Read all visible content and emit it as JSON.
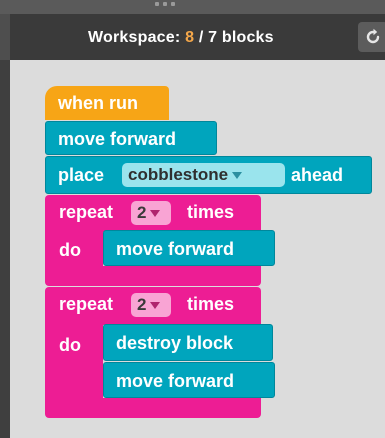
{
  "header": {
    "title_prefix": "Workspace: ",
    "blocks_used": "8",
    "title_suffix": " / 7 blocks"
  },
  "colors": {
    "event_block": "#f7a516",
    "action_block": "#00a5bd",
    "loop_block": "#ed1d94",
    "over_limit": "#f4a74a"
  },
  "program": {
    "when_run": "when run",
    "move_forward_1": "move forward",
    "place_label": "place",
    "place_block_option": "cobblestone",
    "place_suffix": "ahead",
    "repeat1": {
      "label": "repeat",
      "count": "2",
      "suffix": "times",
      "do_label": "do",
      "body": [
        "move forward"
      ]
    },
    "repeat2": {
      "label": "repeat",
      "count": "2",
      "suffix": "times",
      "do_label": "do",
      "body": [
        "destroy block",
        "move forward"
      ]
    }
  }
}
